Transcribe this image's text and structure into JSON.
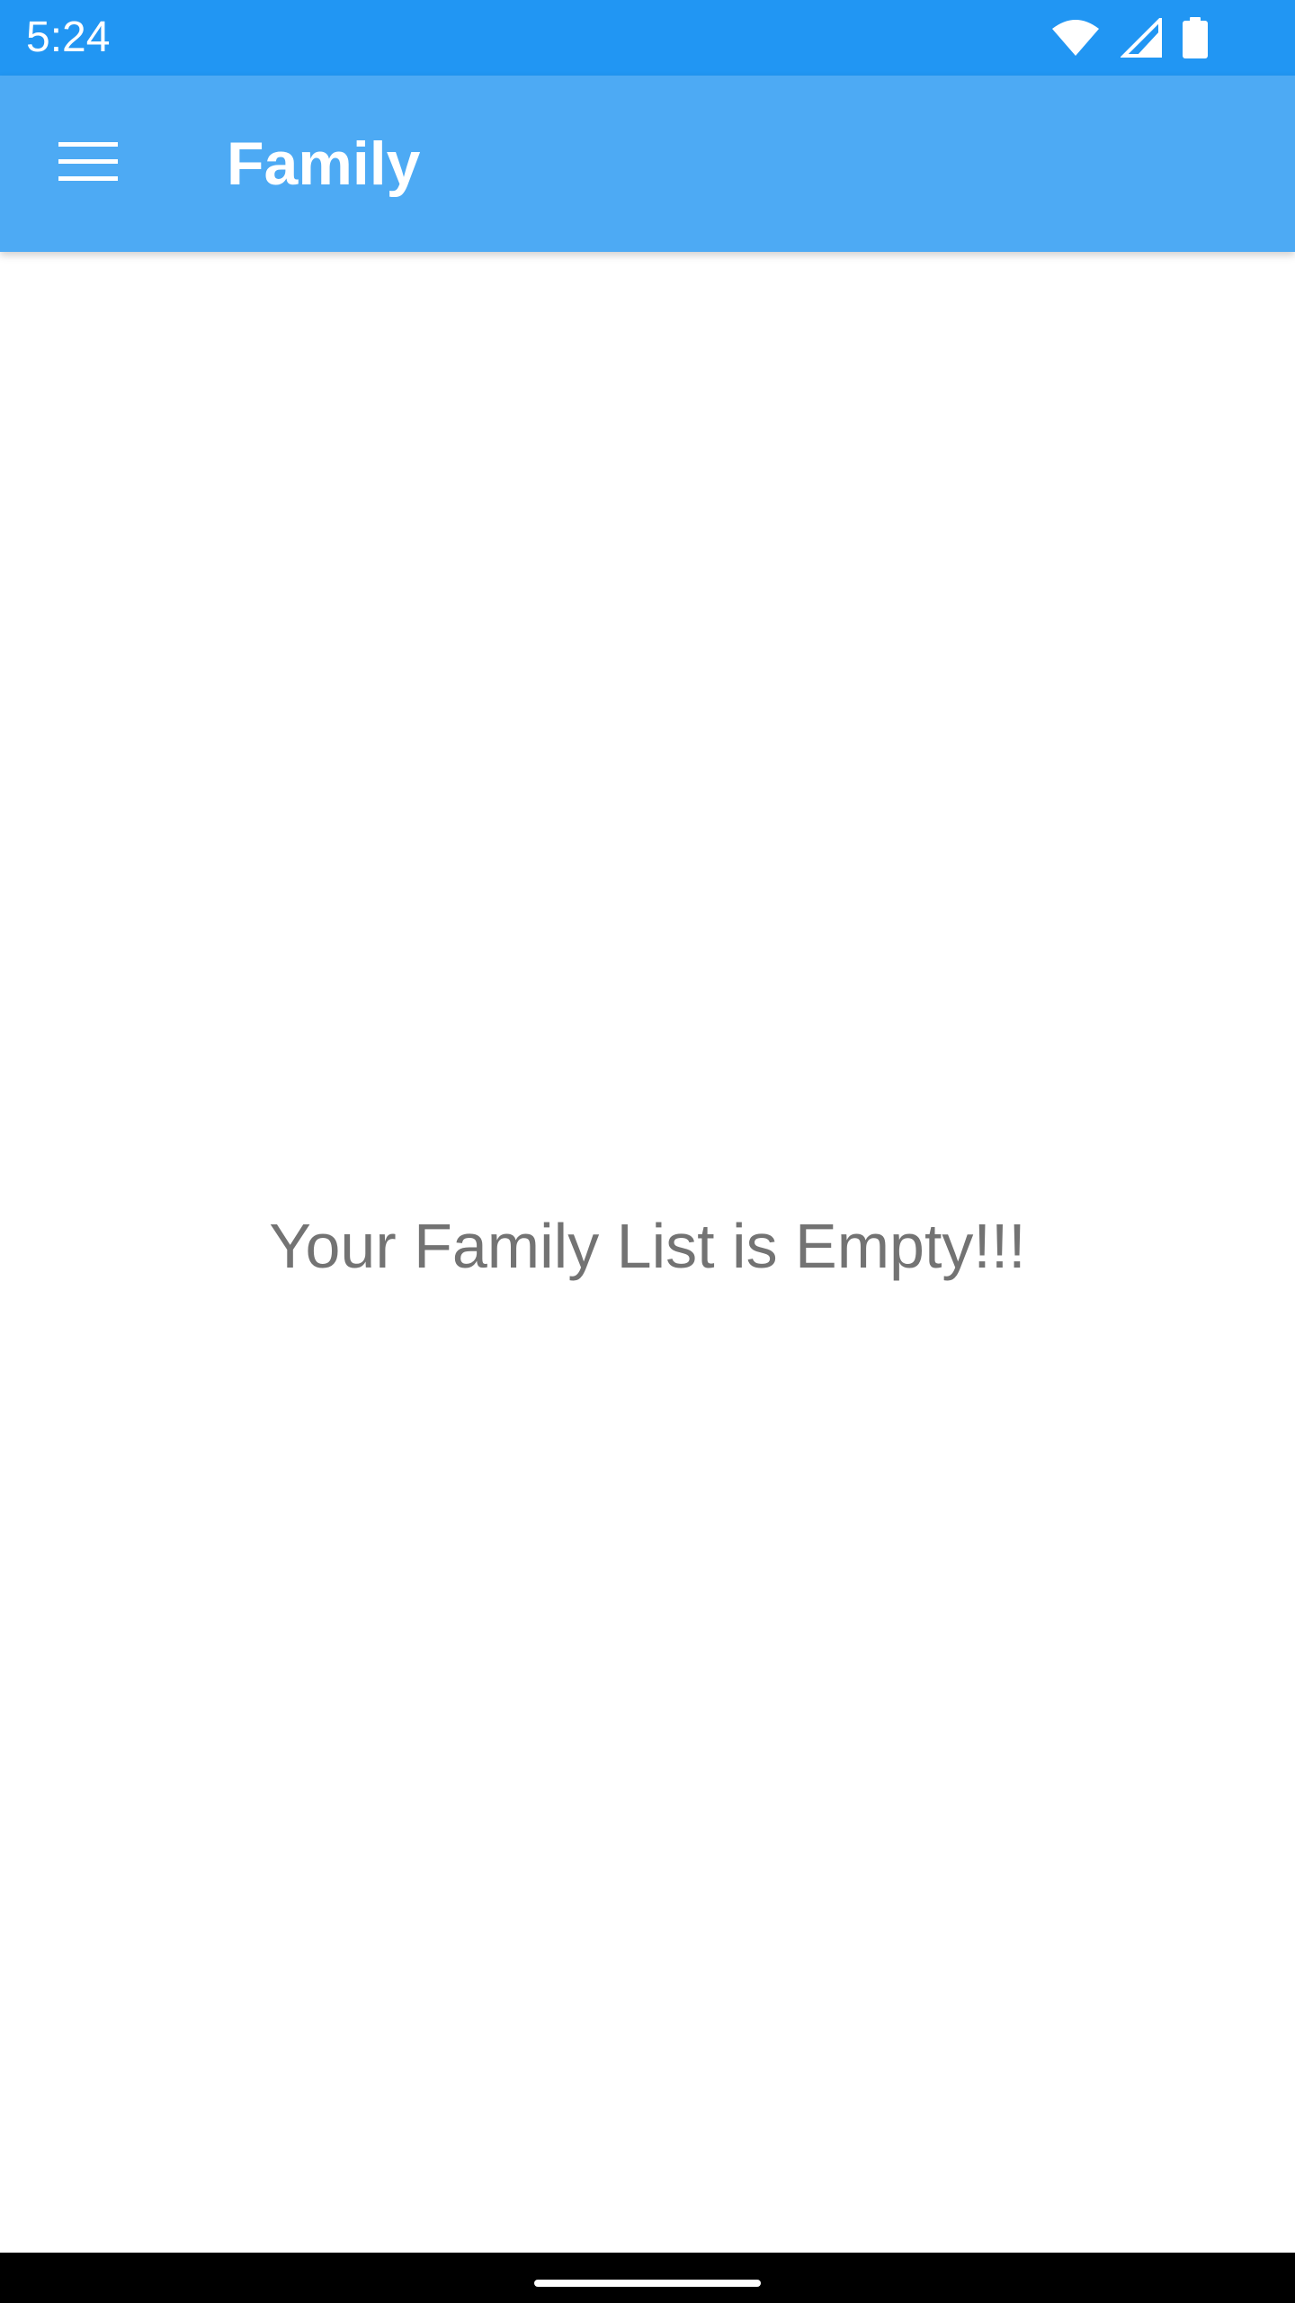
{
  "status_bar": {
    "time": "5:24",
    "icons": [
      "wifi-icon",
      "cell-signal-icon",
      "battery-icon"
    ],
    "background_color": "#2196F3"
  },
  "app_bar": {
    "title": "Family",
    "menu_icon": "hamburger-menu-icon",
    "background_color": "#4DAAF4"
  },
  "content": {
    "empty_message": "Your Family List is Empty!!!",
    "text_color": "#737373"
  },
  "nav_bar": {
    "background_color": "#000000"
  }
}
